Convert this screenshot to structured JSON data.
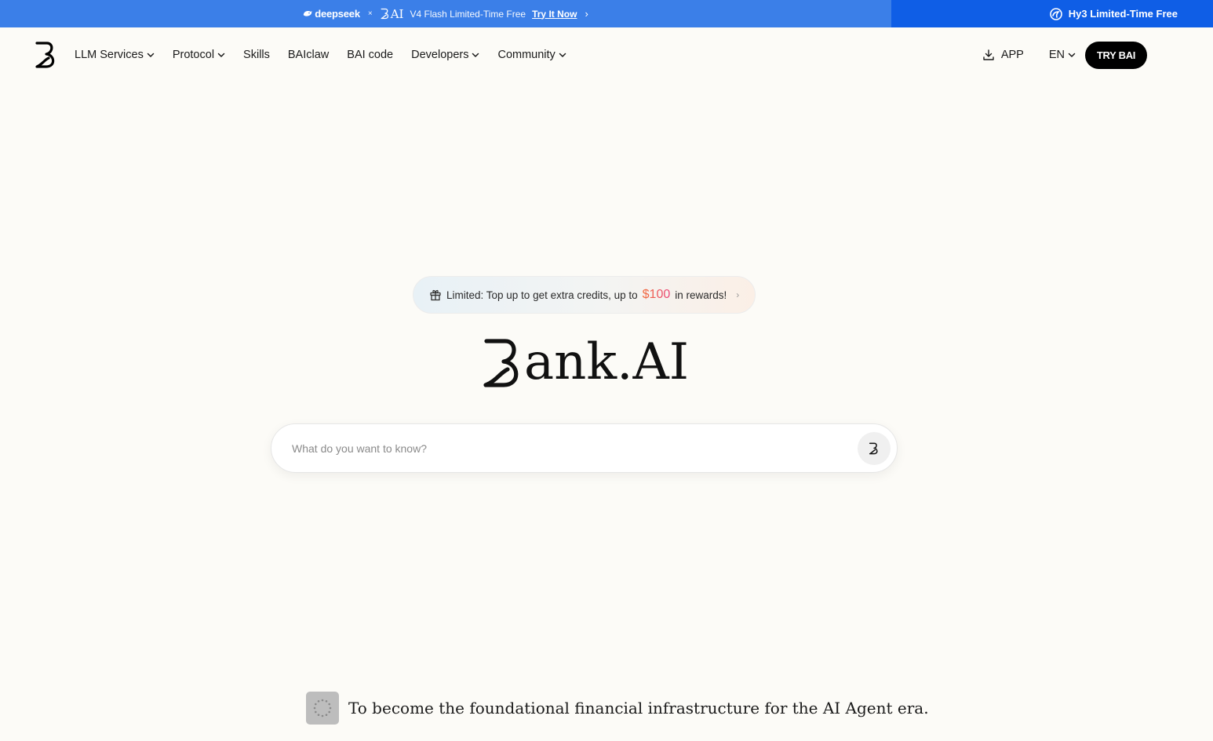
{
  "banner": {
    "left": {
      "partner_brand": "deepseek",
      "times": "×",
      "bai_mark": "AI",
      "text": "V4 Flash Limited-Time Free",
      "link": "Try It Now",
      "chevron": "›"
    },
    "right": {
      "text": "Hy3 Limited-Time Free",
      "icon": "hy-logo-icon"
    },
    "colors": {
      "left_bg": "#3b7fe8",
      "right_bg": "#0f5ee6"
    }
  },
  "nav": {
    "logo_icon": "bank-ai-logo-icon",
    "items": [
      {
        "label": "LLM Services",
        "has_dropdown": true
      },
      {
        "label": "Protocol",
        "has_dropdown": true
      },
      {
        "label": "Skills",
        "has_dropdown": false
      },
      {
        "label": "BAIclaw",
        "has_dropdown": false
      },
      {
        "label": "BAI code",
        "has_dropdown": false
      },
      {
        "label": "Developers",
        "has_dropdown": true
      },
      {
        "label": "Community",
        "has_dropdown": true
      }
    ],
    "app_label": "APP",
    "app_icon": "download-icon",
    "lang_label": "EN",
    "cta_label": "TRY BAI"
  },
  "promo": {
    "icon": "gift-icon",
    "text_before": "Limited: Top up to get extra credits, up to",
    "amount": "$100",
    "text_after": "in rewards!",
    "chevron": "›"
  },
  "hero": {
    "wordmark": "ank.AI"
  },
  "search": {
    "placeholder": "What do you want to know?",
    "value": "",
    "submit_icon": "bank-ai-logo-icon"
  },
  "tagline": {
    "thumbnail_icon": "loading-spinner-icon",
    "text": "To become the foundational financial infrastructure for the AI Agent era."
  },
  "colors": {
    "page_bg": "#fcfbf7",
    "cta_bg": "#000000",
    "accent_gradient_start": "#f26a3a",
    "accent_gradient_end": "#e9467a"
  }
}
